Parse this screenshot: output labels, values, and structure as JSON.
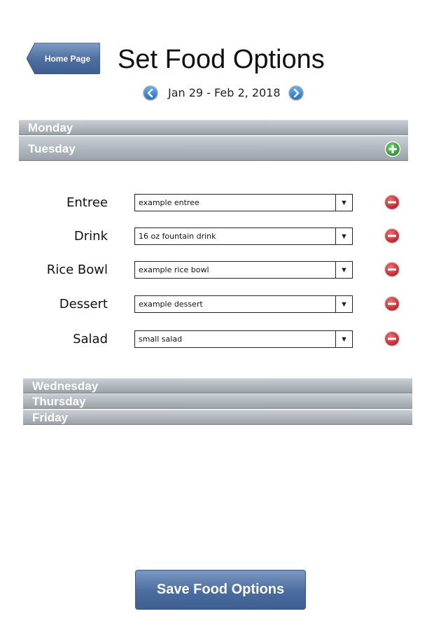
{
  "header": {
    "home_label": "Home Page",
    "title": "Set Food Options"
  },
  "week_nav": {
    "range": "Jan 29 - Feb 2, 2018",
    "prev_icon": "chevron-left-icon",
    "next_icon": "chevron-right-icon"
  },
  "days": {
    "monday": "Monday",
    "tuesday": "Tuesday",
    "wednesday": "Wednesday",
    "thursday": "Thursday",
    "friday": "Friday"
  },
  "tuesday_options": [
    {
      "label": "Entree",
      "value": "example entree"
    },
    {
      "label": "Drink",
      "value": "16 oz fountain drink"
    },
    {
      "label": "Rice Bowl",
      "value": "example rice bowl"
    },
    {
      "label": "Dessert",
      "value": "example dessert"
    },
    {
      "label": "Salad",
      "value": "small salad"
    }
  ],
  "icons": {
    "add": "plus-circle-icon",
    "remove": "minus-circle-icon",
    "dropdown": "triangle-down-icon"
  },
  "colors": {
    "bar_top": "#c8ced3",
    "bar_bottom": "#9aa2a9",
    "button_blue": "#4a6c9e",
    "add_green": "#2e9a33",
    "remove_red": "#c8262c",
    "nav_blue": "#2f7fd0"
  },
  "footer": {
    "save_label": "Save Food Options"
  }
}
